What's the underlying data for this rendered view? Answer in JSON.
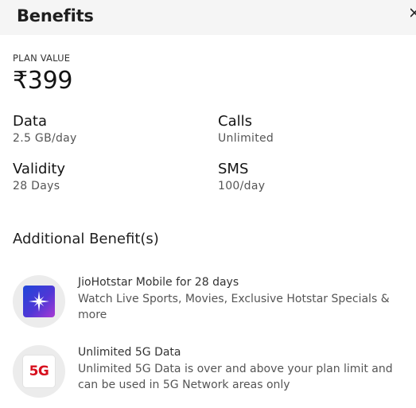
{
  "header": {
    "title": "Benefits",
    "close_icon": "close-icon"
  },
  "plan": {
    "label": "PLAN VALUE",
    "value": "₹399"
  },
  "benefits": [
    {
      "title": "Data",
      "value": "2.5 GB/day"
    },
    {
      "title": "Calls",
      "value": "Unlimited"
    },
    {
      "title": "Validity",
      "value": "28 Days"
    },
    {
      "title": "SMS",
      "value": "100/day"
    }
  ],
  "additional": {
    "heading": "Additional Benefit(s)",
    "items": [
      {
        "icon": "jiohotstar-logo-icon",
        "title": "JioHotstar Mobile for 28 days",
        "description": "Watch Live Sports, Movies, Exclusive Hotstar Specials & more"
      },
      {
        "icon": "5g-icon",
        "icon_text": "5G",
        "title": "Unlimited 5G Data",
        "description": "Unlimited 5G Data is over and above your plan limit and can be used in 5G Network areas only"
      }
    ]
  },
  "colors": {
    "header_bg": "#f5f5f5",
    "icon_circle_bg": "#ececec",
    "fiveg_red": "#d7101e"
  }
}
